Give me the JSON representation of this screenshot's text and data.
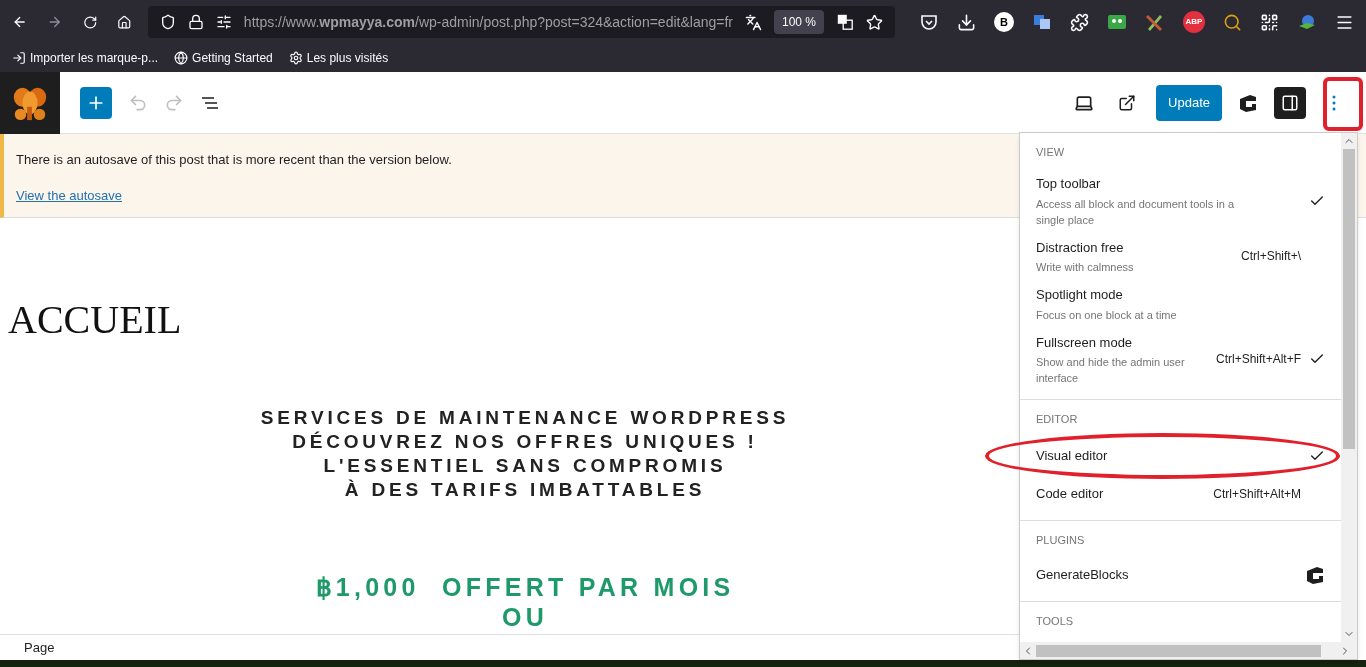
{
  "browser": {
    "url": "https://www.**wpmayya.com**/wp-admin/post.php?post=324&action=edit&lang=fr",
    "zoom": "100 %",
    "extensions": [
      {
        "kind": "pocket"
      },
      {
        "kind": "download"
      },
      {
        "kind": "letter",
        "label": "B"
      },
      {
        "kind": "translate"
      },
      {
        "kind": "puzzle"
      },
      {
        "kind": "tape"
      },
      {
        "kind": "pencil"
      },
      {
        "kind": "stop",
        "label": "ABP"
      },
      {
        "kind": "magnifier"
      },
      {
        "kind": "qr"
      },
      {
        "kind": "globe"
      },
      {
        "kind": "menu"
      }
    ],
    "bookmarks": [
      {
        "kind": "import",
        "label": "Importer les marque-p..."
      },
      {
        "kind": "globe",
        "label": "Getting Started"
      },
      {
        "kind": "gear",
        "label": "Les plus visités"
      }
    ]
  },
  "toolbar": {
    "update_button": "Update",
    "settings_active": true
  },
  "notice": {
    "text": "There is an autosave of this post that is more recent than the version below.",
    "link": "View the autosave"
  },
  "content": {
    "title": "ACCUEIL",
    "headline": [
      "SERVICES DE MAINTENANCE WORDPRESS",
      "DÉCOUVREZ NOS OFFRES UNIQUES !",
      "L'ESSENTIEL SANS COMPROMIS",
      "À DES TARIFS IMBATTABLES"
    ],
    "offer": [
      "฿1,000  OFFERT PAR MOIS",
      "OU"
    ]
  },
  "footer": {
    "breadcrumb": "Page"
  },
  "menu": {
    "sections": [
      {
        "title": "VIEW",
        "items": [
          {
            "kind": "toggle",
            "label": "Top toolbar",
            "description": "Access all block and document tools in a single place",
            "checked": true
          },
          {
            "kind": "toggle",
            "label": "Distraction free",
            "description": "Write with calmness",
            "shortcut": "Ctrl+Shift+\\",
            "checked": false
          },
          {
            "kind": "toggle",
            "label": "Spotlight mode",
            "description": "Focus on one block at a time",
            "checked": false
          },
          {
            "kind": "toggle",
            "label": "Fullscreen mode",
            "description": "Show and hide the admin user interface",
            "shortcut": "Ctrl+Shift+Alt+F",
            "checked": true
          }
        ]
      },
      {
        "title": "EDITOR",
        "items": [
          {
            "kind": "toggle",
            "label": "Visual editor",
            "checked": true,
            "highlighted": true
          },
          {
            "kind": "toggle",
            "label": "Code editor",
            "shortcut": "Ctrl+Shift+Alt+M",
            "checked": false
          }
        ]
      },
      {
        "title": "PLUGINS",
        "items": [
          {
            "kind": "plugin",
            "label": "GenerateBlocks"
          }
        ]
      },
      {
        "title": "TOOLS"
      }
    ]
  },
  "annotations": {
    "more_button_highlighted": true
  }
}
